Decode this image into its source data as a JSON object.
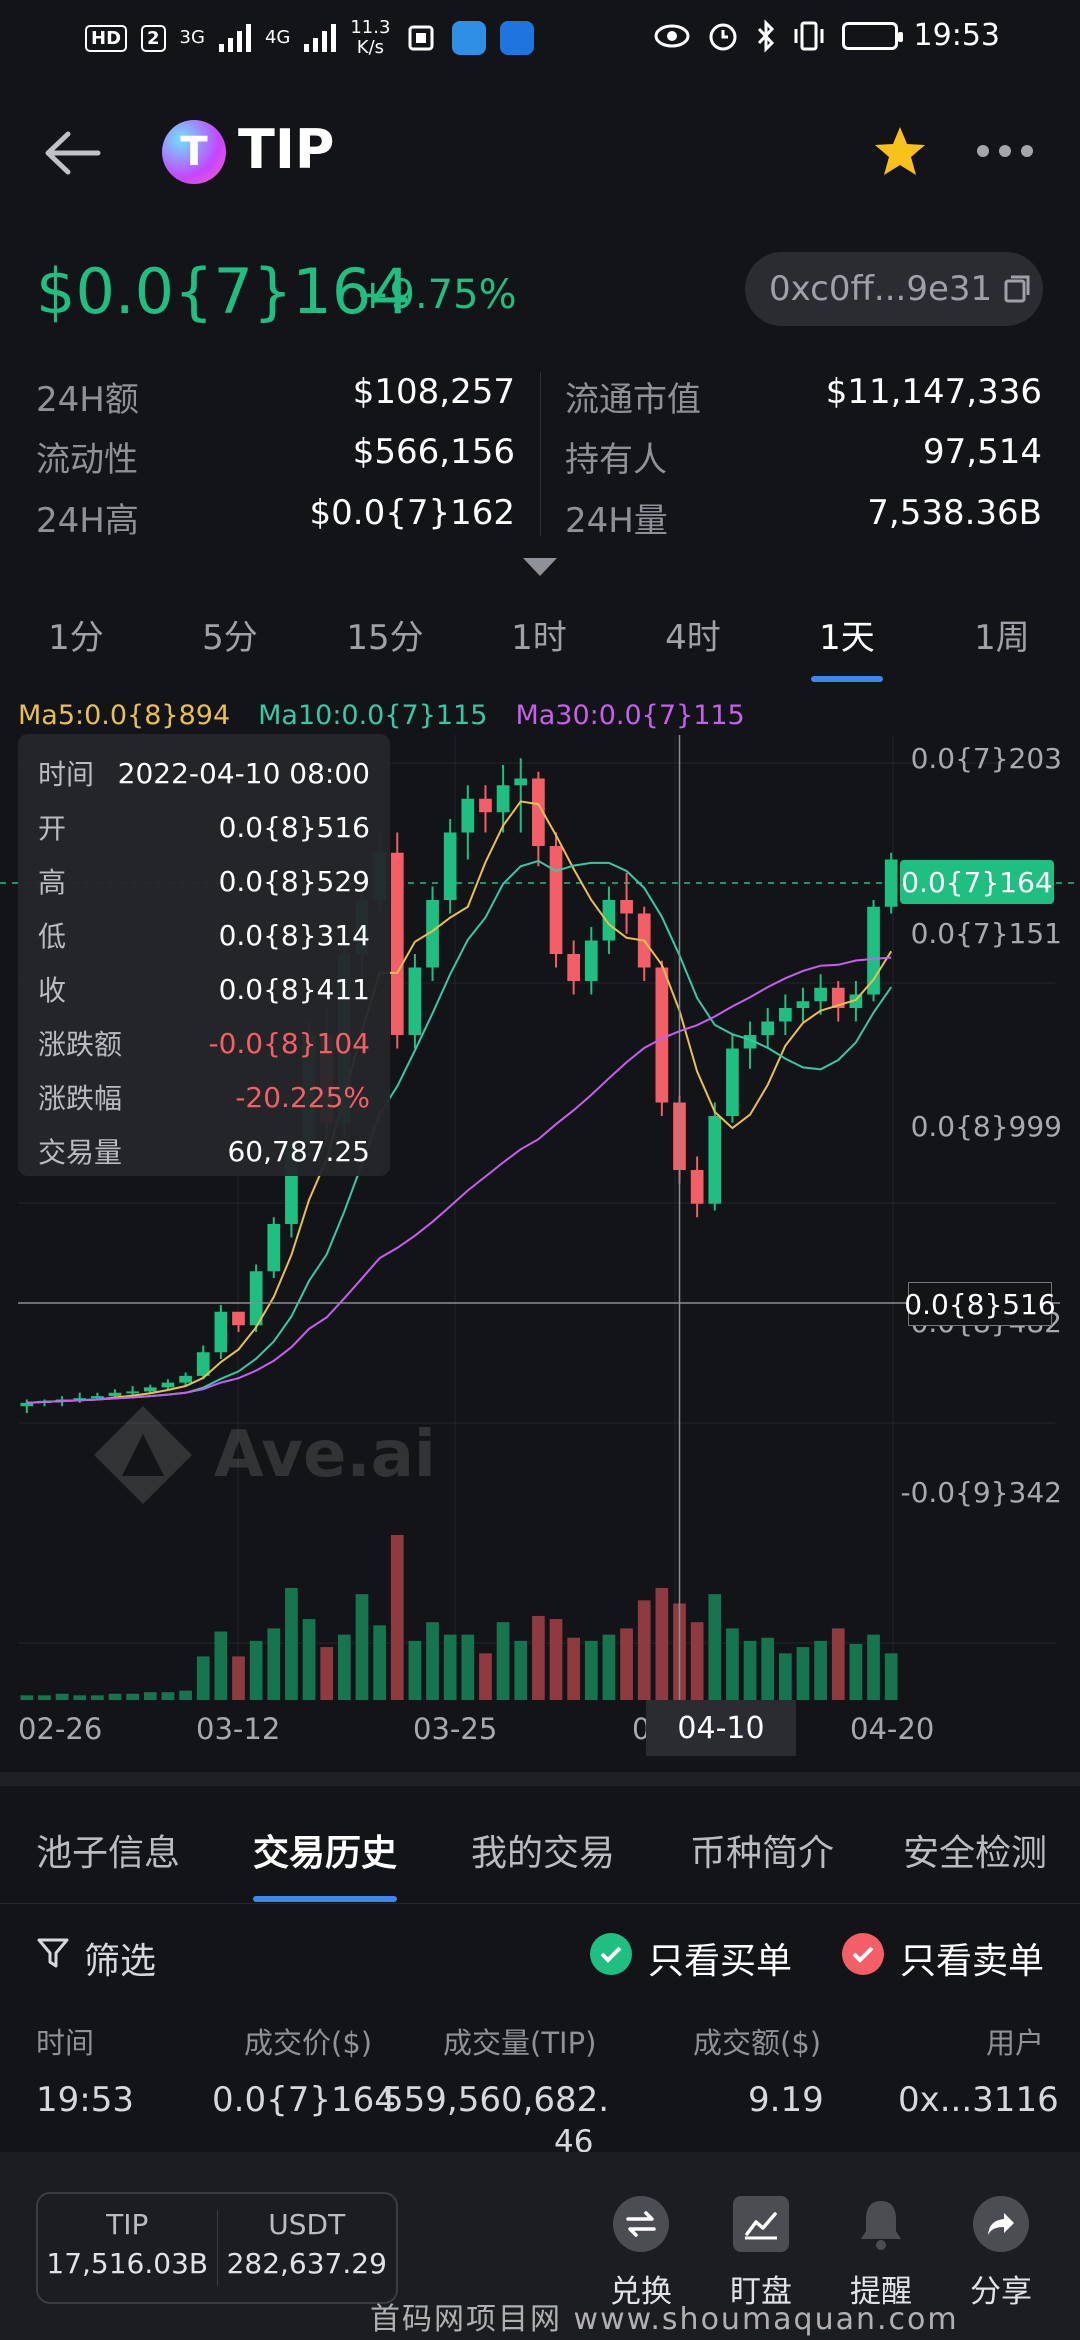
{
  "status_bar": {
    "hd": "HD",
    "sim": "2",
    "net1": "3G",
    "net2": "4G",
    "speed_value": "11.3",
    "speed_unit": "K/s",
    "time": "19:53"
  },
  "header": {
    "logo_letter": "T",
    "symbol": "TIP"
  },
  "price": {
    "value": "$0.0{7}164",
    "change": "+9.75%",
    "address": "0xc0ff...9e31"
  },
  "stats": {
    "left": [
      {
        "label": "24H额",
        "value": "$108,257"
      },
      {
        "label": "流动性",
        "value": "$566,156"
      },
      {
        "label": "24H高",
        "value": "$0.0{7}162"
      }
    ],
    "right": [
      {
        "label": "流通市值",
        "value": "$11,147,336"
      },
      {
        "label": "持有人",
        "value": "97,514"
      },
      {
        "label": "24H量",
        "value": "7,538.36B"
      }
    ]
  },
  "timeframes": [
    "1分",
    "5分",
    "15分",
    "1时",
    "4时",
    "1天",
    "1周"
  ],
  "active_timeframe": "1天",
  "ma": {
    "ma5": "Ma5:0.0{8}894",
    "ma10": "Ma10:0.0{7}115",
    "ma30": "Ma30:0.0{7}115"
  },
  "ohlc": [
    {
      "k": "时间",
      "v": "2022-04-10 08:00"
    },
    {
      "k": "开",
      "v": "0.0{8}516"
    },
    {
      "k": "高",
      "v": "0.0{8}529"
    },
    {
      "k": "低",
      "v": "0.0{8}314"
    },
    {
      "k": "收",
      "v": "0.0{8}411"
    },
    {
      "k": "涨跌额",
      "v": "-0.0{8}104"
    },
    {
      "k": "涨跌幅",
      "v": "-20.225%"
    },
    {
      "k": "交易量",
      "v": "60,787.25"
    }
  ],
  "chart_data": {
    "type": "candlestick",
    "price_axis_labels": [
      "0.0{7}203",
      "0.0{7}151",
      "0.0{8}999",
      "0.0{8}482",
      "-0.0{9}342"
    ],
    "current_price_tag": "0.0{7}164",
    "crosshair_price_tag": "0.0{8}516",
    "date_labels": [
      "02-26",
      "03-12",
      "03-25",
      "0",
      "04-20"
    ],
    "crosshair_date": "04-10",
    "ma_colors": {
      "ma5": "#e9c04a",
      "ma10": "#35c9a6",
      "ma30": "#c65ff0"
    },
    "candles": [
      {
        "o": 0.05,
        "h": 0.06,
        "l": 0.04,
        "c": 0.055,
        "v": 0.3
      },
      {
        "o": 0.055,
        "h": 0.06,
        "l": 0.05,
        "c": 0.058,
        "v": 0.3
      },
      {
        "o": 0.058,
        "h": 0.065,
        "l": 0.05,
        "c": 0.06,
        "v": 0.4
      },
      {
        "o": 0.06,
        "h": 0.07,
        "l": 0.055,
        "c": 0.062,
        "v": 0.3
      },
      {
        "o": 0.062,
        "h": 0.07,
        "l": 0.06,
        "c": 0.065,
        "v": 0.3
      },
      {
        "o": 0.065,
        "h": 0.075,
        "l": 0.06,
        "c": 0.07,
        "v": 0.4
      },
      {
        "o": 0.07,
        "h": 0.08,
        "l": 0.065,
        "c": 0.072,
        "v": 0.4
      },
      {
        "o": 0.072,
        "h": 0.082,
        "l": 0.07,
        "c": 0.078,
        "v": 0.5
      },
      {
        "o": 0.078,
        "h": 0.09,
        "l": 0.075,
        "c": 0.085,
        "v": 0.5
      },
      {
        "o": 0.085,
        "h": 0.1,
        "l": 0.08,
        "c": 0.095,
        "v": 0.6
      },
      {
        "o": 0.095,
        "h": 0.14,
        "l": 0.09,
        "c": 0.13,
        "v": 2.8
      },
      {
        "o": 0.13,
        "h": 0.2,
        "l": 0.12,
        "c": 0.19,
        "v": 4.4
      },
      {
        "o": 0.19,
        "h": 0.185,
        "l": 0.16,
        "c": 0.17,
        "v": 2.8
      },
      {
        "o": 0.17,
        "h": 0.26,
        "l": 0.16,
        "c": 0.25,
        "v": 3.8
      },
      {
        "o": 0.25,
        "h": 0.33,
        "l": 0.24,
        "c": 0.32,
        "v": 4.6
      },
      {
        "o": 0.32,
        "h": 0.45,
        "l": 0.3,
        "c": 0.44,
        "v": 7.2
      },
      {
        "o": 0.44,
        "h": 0.62,
        "l": 0.42,
        "c": 0.6,
        "v": 5.2
      },
      {
        "o": 0.6,
        "h": 0.64,
        "l": 0.44,
        "c": 0.47,
        "v": 3.4
      },
      {
        "o": 0.47,
        "h": 0.74,
        "l": 0.45,
        "c": 0.72,
        "v": 4.2
      },
      {
        "o": 0.72,
        "h": 0.82,
        "l": 0.68,
        "c": 0.8,
        "v": 6.8
      },
      {
        "o": 0.8,
        "h": 0.9,
        "l": 0.78,
        "c": 0.87,
        "v": 4.8
      },
      {
        "o": 0.87,
        "h": 0.9,
        "l": 0.58,
        "c": 0.6,
        "v": 10.6
      },
      {
        "o": 0.6,
        "h": 0.72,
        "l": 0.58,
        "c": 0.7,
        "v": 3.8
      },
      {
        "o": 0.7,
        "h": 0.82,
        "l": 0.68,
        "c": 0.8,
        "v": 5.0
      },
      {
        "o": 0.8,
        "h": 0.92,
        "l": 0.78,
        "c": 0.9,
        "v": 4.2
      },
      {
        "o": 0.9,
        "h": 0.97,
        "l": 0.86,
        "c": 0.95,
        "v": 4.2
      },
      {
        "o": 0.95,
        "h": 0.97,
        "l": 0.9,
        "c": 0.93,
        "v": 3.0
      },
      {
        "o": 0.93,
        "h": 1.0,
        "l": 0.9,
        "c": 0.97,
        "v": 5.0
      },
      {
        "o": 0.97,
        "h": 1.01,
        "l": 0.9,
        "c": 0.98,
        "v": 3.8
      },
      {
        "o": 0.98,
        "h": 0.99,
        "l": 0.85,
        "c": 0.88,
        "v": 5.4
      },
      {
        "o": 0.88,
        "h": 0.9,
        "l": 0.7,
        "c": 0.72,
        "v": 5.2
      },
      {
        "o": 0.72,
        "h": 0.74,
        "l": 0.66,
        "c": 0.68,
        "v": 4.0
      },
      {
        "o": 0.68,
        "h": 0.76,
        "l": 0.66,
        "c": 0.74,
        "v": 3.8
      },
      {
        "o": 0.74,
        "h": 0.82,
        "l": 0.72,
        "c": 0.8,
        "v": 4.2
      },
      {
        "o": 0.8,
        "h": 0.84,
        "l": 0.75,
        "c": 0.78,
        "v": 4.6
      },
      {
        "o": 0.78,
        "h": 0.79,
        "l": 0.68,
        "c": 0.7,
        "v": 6.4
      },
      {
        "o": 0.7,
        "h": 0.71,
        "l": 0.48,
        "c": 0.5,
        "v": 7.2
      },
      {
        "o": 0.5,
        "h": 0.51,
        "l": 0.38,
        "c": 0.4,
        "v": 6.2
      },
      {
        "o": 0.4,
        "h": 0.42,
        "l": 0.33,
        "c": 0.35,
        "v": 5.0
      },
      {
        "o": 0.35,
        "h": 0.5,
        "l": 0.34,
        "c": 0.48,
        "v": 6.8
      },
      {
        "o": 0.48,
        "h": 0.6,
        "l": 0.47,
        "c": 0.58,
        "v": 4.6
      },
      {
        "o": 0.58,
        "h": 0.62,
        "l": 0.55,
        "c": 0.6,
        "v": 3.8
      },
      {
        "o": 0.6,
        "h": 0.64,
        "l": 0.58,
        "c": 0.62,
        "v": 4.0
      },
      {
        "o": 0.62,
        "h": 0.66,
        "l": 0.6,
        "c": 0.64,
        "v": 3.0
      },
      {
        "o": 0.64,
        "h": 0.67,
        "l": 0.62,
        "c": 0.65,
        "v": 3.4
      },
      {
        "o": 0.65,
        "h": 0.69,
        "l": 0.63,
        "c": 0.67,
        "v": 3.8
      },
      {
        "o": 0.67,
        "h": 0.68,
        "l": 0.62,
        "c": 0.64,
        "v": 4.6
      },
      {
        "o": 0.64,
        "h": 0.68,
        "l": 0.62,
        "c": 0.66,
        "v": 3.6
      },
      {
        "o": 0.66,
        "h": 0.8,
        "l": 0.65,
        "c": 0.79,
        "v": 4.2
      },
      {
        "o": 0.79,
        "h": 0.87,
        "l": 0.78,
        "c": 0.86,
        "v": 3.0
      }
    ]
  },
  "watermark": "Ave.ai",
  "section_tabs": [
    "池子信息",
    "交易历史",
    "我的交易",
    "币种简介",
    "安全检测"
  ],
  "active_section_tab": "交易历史",
  "filter": {
    "label": "筛选",
    "buy_only": "只看买单",
    "sell_only": "只看卖单"
  },
  "trade_table": {
    "headers": [
      "时间",
      "成交价($)",
      "成交量(TIP)",
      "成交额($)",
      "用户"
    ],
    "rows": [
      {
        "time": "19:53",
        "price": "0.0{7}164",
        "amount_line1": "559,560,682.",
        "amount_line2": "46",
        "total": "9.19",
        "user": "0x...3116"
      }
    ]
  },
  "bottom": {
    "balances": [
      {
        "symbol": "TIP",
        "amount": "17,516.03B"
      },
      {
        "symbol": "USDT",
        "amount": "282,637.29"
      }
    ],
    "actions": [
      "兑换",
      "盯盘",
      "提醒",
      "分享"
    ],
    "footer_watermark": "首码网项目网 www.shoumaquan.com"
  },
  "colors": {
    "up": "#1fbf82",
    "down": "#f35e67",
    "accent": "#3e86f0",
    "background": "#131417"
  }
}
